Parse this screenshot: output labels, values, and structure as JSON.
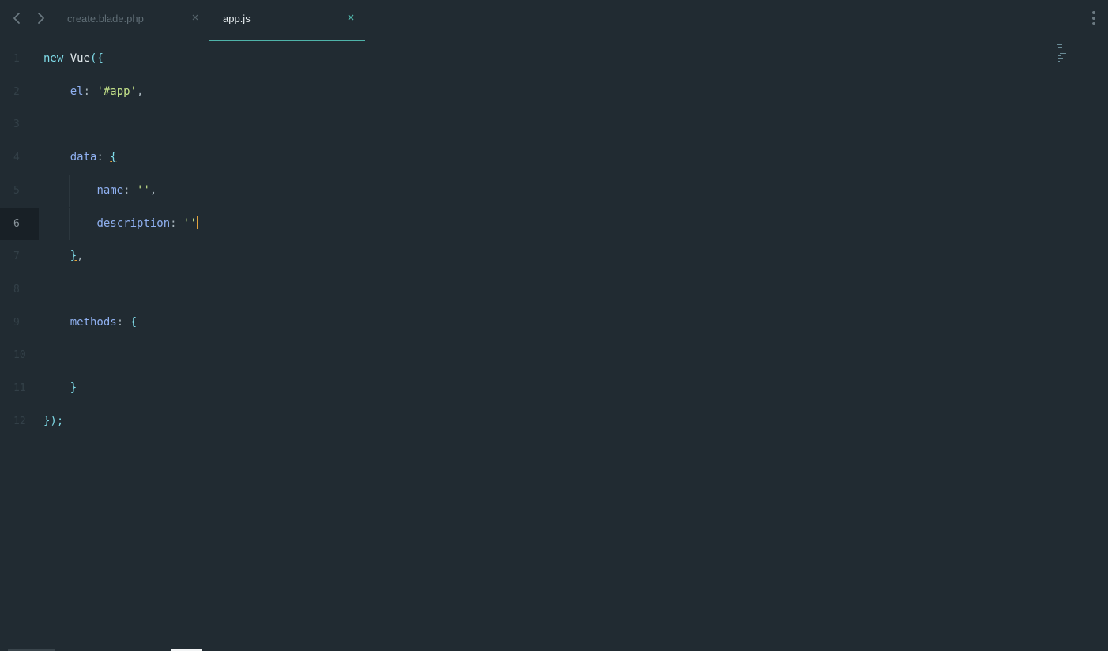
{
  "tabs": [
    {
      "label": "create.blade.php",
      "active": false
    },
    {
      "label": "app.js",
      "active": true
    }
  ],
  "icons": {
    "back": "chevron-left-icon",
    "forward": "chevron-right-icon",
    "close": "close-icon",
    "more": "more-vertical-icon"
  },
  "colors": {
    "background": "#212b32",
    "accent": "#4fb3a9",
    "cursor": "#e3a43d"
  },
  "editor": {
    "current_line": 6,
    "lines": [
      {
        "number": "1",
        "tokens": [
          {
            "t": "new",
            "c": "tok-kw"
          },
          {
            "t": " "
          },
          {
            "t": "Vue",
            "c": "tok-cls"
          },
          {
            "t": "({",
            "c": "tok-brace"
          }
        ]
      },
      {
        "number": "2",
        "tokens": [
          {
            "t": "    "
          },
          {
            "t": "el",
            "c": "tok-prop"
          },
          {
            "t": ": ",
            "c": "tok-punc"
          },
          {
            "t": "'#app'",
            "c": "tok-str"
          },
          {
            "t": ",",
            "c": "tok-punc"
          }
        ]
      },
      {
        "number": "3",
        "tokens": []
      },
      {
        "number": "4",
        "tokens": [
          {
            "t": "    "
          },
          {
            "t": "data",
            "c": "tok-prop"
          },
          {
            "t": ": ",
            "c": "tok-punc"
          },
          {
            "t": "{",
            "c": "tok-brace-u"
          }
        ]
      },
      {
        "number": "5",
        "tokens": [
          {
            "t": "        "
          },
          {
            "t": "name",
            "c": "tok-prop"
          },
          {
            "t": ": ",
            "c": "tok-punc"
          },
          {
            "t": "''",
            "c": "tok-str"
          },
          {
            "t": ",",
            "c": "tok-punc"
          }
        ]
      },
      {
        "number": "6",
        "tokens": [
          {
            "t": "        "
          },
          {
            "t": "description",
            "c": "tok-prop"
          },
          {
            "t": ": ",
            "c": "tok-punc"
          },
          {
            "t": "''",
            "c": "tok-str"
          }
        ]
      },
      {
        "number": "7",
        "tokens": [
          {
            "t": "    "
          },
          {
            "t": "}",
            "c": "tok-brace-u"
          },
          {
            "t": ",",
            "c": "tok-punc"
          }
        ]
      },
      {
        "number": "8",
        "tokens": []
      },
      {
        "number": "9",
        "tokens": [
          {
            "t": "    "
          },
          {
            "t": "methods",
            "c": "tok-prop"
          },
          {
            "t": ": ",
            "c": "tok-punc"
          },
          {
            "t": "{",
            "c": "tok-brace"
          }
        ]
      },
      {
        "number": "10",
        "tokens": []
      },
      {
        "number": "11",
        "tokens": [
          {
            "t": "    "
          },
          {
            "t": "}",
            "c": "tok-brace"
          }
        ]
      },
      {
        "number": "12",
        "tokens": [
          {
            "t": "});",
            "c": "tok-brace"
          }
        ]
      }
    ]
  }
}
